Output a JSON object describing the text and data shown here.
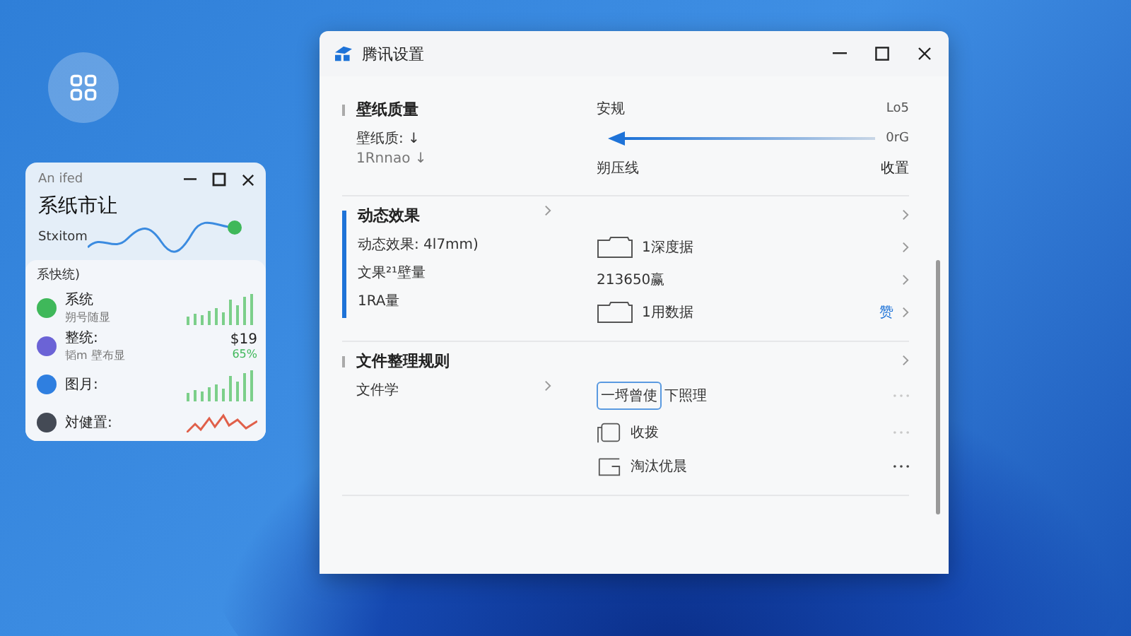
{
  "widget": {
    "title": "An ifed",
    "heading": "系纸市让",
    "subtitle": "Stxitom",
    "section": "系快统)",
    "items": [
      {
        "name": "系统",
        "sub": "朔号随显",
        "kind": "bars",
        "color": "#3fb85a"
      },
      {
        "name": "整统:",
        "sub": "韬m  壁布显",
        "kind": "value",
        "value": "$19",
        "change": "65%",
        "color": "#6b63d6"
      },
      {
        "name": "图月:",
        "kind": "bars",
        "color": "#2f7fe0"
      },
      {
        "name": "対健置:",
        "kind": "spikes",
        "color": "#444a55"
      }
    ]
  },
  "window": {
    "title": "腾讯设置",
    "sections": [
      {
        "title": "壁纸质量",
        "selected": false,
        "kind": "slider",
        "left": [
          {
            "text": "壁纸质: ↓"
          },
          {
            "text": "1Rnnao ↓"
          }
        ],
        "slider": {
          "label": "安规",
          "top_reading": "Lo5",
          "bottom_reading": "0rG",
          "level": 0.04,
          "below_label": "朔压线",
          "action": "收置"
        }
      },
      {
        "title": "动态效果",
        "selected": true,
        "kind": "chevrons",
        "left": [
          {
            "text": "动态效果: 4l7mm)"
          },
          {
            "text": "文果²¹壁量"
          },
          {
            "text": "1RA量"
          }
        ],
        "rows": [
          {
            "kind": "blank"
          },
          {
            "kind": "folder",
            "text": "1深度据"
          },
          {
            "kind": "plain",
            "text": "213650赢"
          },
          {
            "kind": "folder",
            "text": "1用数据",
            "tag": "赞"
          }
        ]
      },
      {
        "title": "文件整理规则",
        "selected": false,
        "kind": "menu",
        "left": [
          {
            "text": "文件学"
          }
        ],
        "rows": [
          {
            "kind": "blank"
          },
          {
            "kind": "boxed",
            "text": "一埒曾使",
            "extra": "下照理"
          },
          {
            "kind": "copy",
            "text": "收拨"
          },
          {
            "kind": "tray",
            "text": "淘汰优晨"
          }
        ]
      }
    ]
  }
}
